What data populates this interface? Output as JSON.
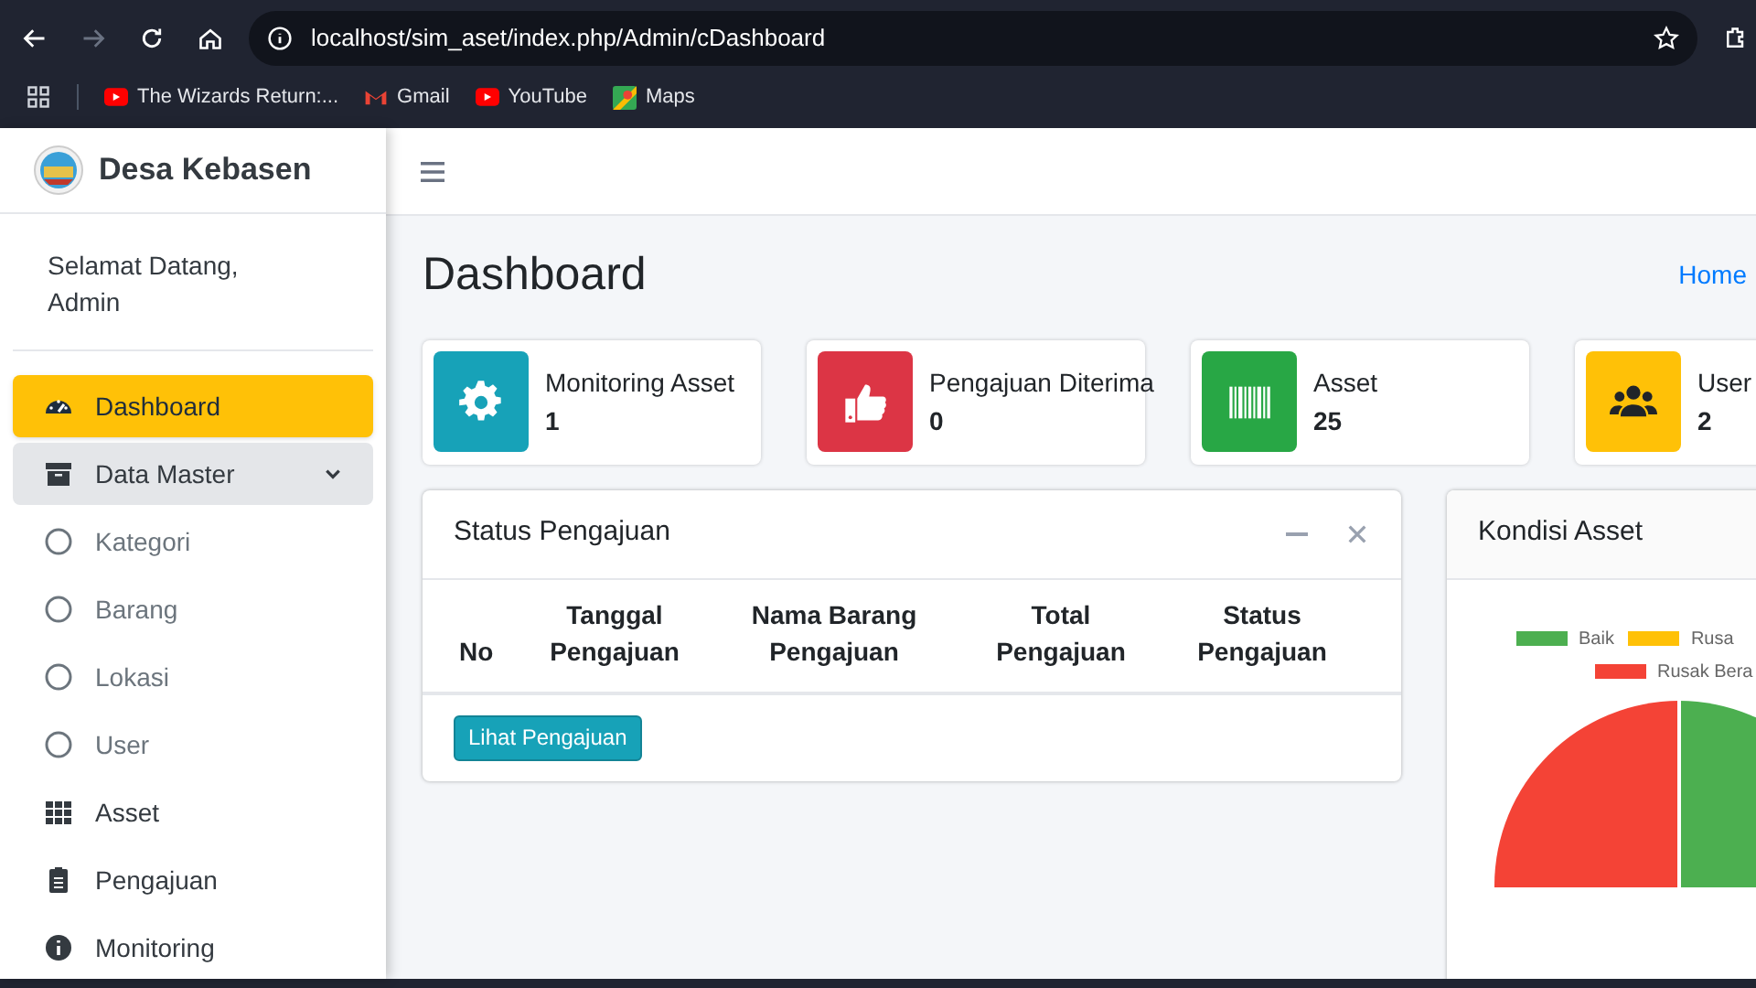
{
  "browser": {
    "url": "localhost/sim_aset/index.php/Admin/cDashboard",
    "bookmarks": [
      {
        "label": "The Wizards Return:...",
        "kind": "youtube"
      },
      {
        "label": "Gmail",
        "kind": "gmail"
      },
      {
        "label": "YouTube",
        "kind": "youtube"
      },
      {
        "label": "Maps",
        "kind": "maps"
      }
    ]
  },
  "sidebar": {
    "brand": "Desa Kebasen",
    "welcome": "Selamat Datang, Admin",
    "items": [
      {
        "label": "Dashboard",
        "kind": "gauge",
        "selected": true
      },
      {
        "label": "Data Master",
        "kind": "archive",
        "selected": false,
        "expanded": true
      },
      {
        "label": "Kategori",
        "kind": "circle",
        "selected": false
      },
      {
        "label": "Barang",
        "kind": "circle",
        "selected": false
      },
      {
        "label": "Lokasi",
        "kind": "circle",
        "selected": false
      },
      {
        "label": "User",
        "kind": "circle",
        "selected": false
      },
      {
        "label": "Asset",
        "kind": "grid",
        "selected": false
      },
      {
        "label": "Pengajuan",
        "kind": "clipboard",
        "selected": false
      },
      {
        "label": "Monitoring",
        "kind": "info",
        "selected": false
      }
    ]
  },
  "header": {
    "title": "Dashboard",
    "breadcrumb": "Home"
  },
  "info_boxes": [
    {
      "label": "Monitoring Asset",
      "value": "1",
      "color": "#17a2b8",
      "kind": "gear"
    },
    {
      "label": "Pengajuan Diterima",
      "value": "0",
      "color": "#dc3545",
      "kind": "thumb"
    },
    {
      "label": "Asset",
      "value": "25",
      "color": "#28a745",
      "kind": "barcode"
    },
    {
      "label": "User",
      "value": "2",
      "color": "#ffc107",
      "kind": "users"
    }
  ],
  "status_card": {
    "title": "Status Pengajuan",
    "columns": [
      "No",
      "Tanggal Pengajuan",
      "Nama Barang Pengajuan",
      "Total Pengajuan",
      "Status Pengajuan"
    ],
    "button": "Lihat Pengajuan"
  },
  "kondisi_card": {
    "title": "Kondisi Asset",
    "legend": [
      {
        "label": "Baik",
        "color": "#4caf50"
      },
      {
        "label": "Rusa",
        "color": "#ffc107"
      },
      {
        "label": "Rusak Bera",
        "color": "#f44336"
      }
    ]
  }
}
